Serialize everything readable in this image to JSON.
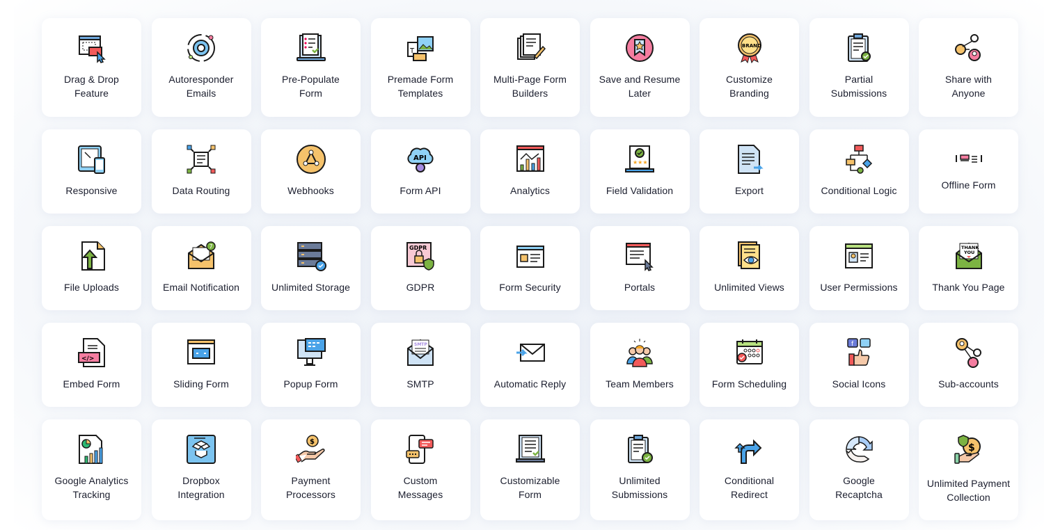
{
  "features": [
    [
      {
        "label": "Drag & Drop\nFeature",
        "icon": "drag-drop-icon"
      },
      {
        "label": "Autoresponder\nEmails",
        "icon": "gear-icon"
      },
      {
        "label": "Pre-Populate\nForm",
        "icon": "laptop-checklist-icon"
      },
      {
        "label": "Premade Form\nTemplates",
        "icon": "templates-icon"
      },
      {
        "label": "Multi-Page Form\nBuilders",
        "icon": "multi-page-icon"
      },
      {
        "label": "Save and Resume\nLater",
        "icon": "bookmark-icon"
      },
      {
        "label": "Customize\nBranding",
        "icon": "brand-badge-icon"
      },
      {
        "label": "Partial\nSubmissions",
        "icon": "clipboard-icon"
      },
      {
        "label": "Share with\nAnyone",
        "icon": "share-users-icon"
      }
    ],
    [
      {
        "label": "Responsive",
        "icon": "responsive-devices-icon"
      },
      {
        "label": "Data Routing",
        "icon": "data-routing-icon"
      },
      {
        "label": "Webhooks",
        "icon": "webhook-icon"
      },
      {
        "label": "Form API",
        "icon": "api-cloud-icon"
      },
      {
        "label": "Analytics",
        "icon": "analytics-chart-icon"
      },
      {
        "label": "Field Validation",
        "icon": "validation-laptop-icon"
      },
      {
        "label": "Export",
        "icon": "export-document-icon"
      },
      {
        "label": "Conditional Logic",
        "icon": "flowchart-icon"
      },
      {
        "label": "Offline Form",
        "icon": "offline-form-icon"
      }
    ],
    [
      {
        "label": "File Uploads",
        "icon": "file-upload-icon"
      },
      {
        "label": "Email Notification",
        "icon": "email-notification-icon"
      },
      {
        "label": "Unlimited Storage",
        "icon": "server-storage-icon"
      },
      {
        "label": "GDPR",
        "icon": "gdpr-lock-icon"
      },
      {
        "label": "Form Security",
        "icon": "form-security-icon"
      },
      {
        "label": "Portals",
        "icon": "portal-window-icon"
      },
      {
        "label": "Unlimited Views",
        "icon": "views-eye-icon"
      },
      {
        "label": "User Permissions",
        "icon": "user-permissions-icon"
      },
      {
        "label": "Thank You Page",
        "icon": "thank-you-envelope-icon"
      }
    ],
    [
      {
        "label": "Embed Form",
        "icon": "embed-code-icon"
      },
      {
        "label": "Sliding Form",
        "icon": "sliding-form-icon"
      },
      {
        "label": "Popup Form",
        "icon": "popup-monitor-icon"
      },
      {
        "label": "SMTP",
        "icon": "smtp-envelope-icon"
      },
      {
        "label": "Automatic Reply",
        "icon": "auto-reply-envelope-icon"
      },
      {
        "label": "Team Members",
        "icon": "team-members-icon"
      },
      {
        "label": "Form Scheduling",
        "icon": "calendar-icon"
      },
      {
        "label": "Social Icons",
        "icon": "social-thumbs-icon"
      },
      {
        "label": "Sub-accounts",
        "icon": "sub-accounts-icon"
      }
    ],
    [
      {
        "label": "Google Analytics\nTracking",
        "icon": "report-chart-icon"
      },
      {
        "label": "Dropbox\nIntegration",
        "icon": "dropbox-icon"
      },
      {
        "label": "Payment\nProcessors",
        "icon": "payment-hand-icon"
      },
      {
        "label": "Custom\nMessages",
        "icon": "phone-messages-icon"
      },
      {
        "label": "Customizable\nForm",
        "icon": "customizable-laptop-icon"
      },
      {
        "label": "Unlimited\nSubmissions",
        "icon": "submissions-clipboard-icon"
      },
      {
        "label": "Conditional\nRedirect",
        "icon": "redirect-arrows-icon"
      },
      {
        "label": "Google\nRecaptcha",
        "icon": "recaptcha-icon"
      },
      {
        "label": "Unlimited Payment\nCollection",
        "icon": "payment-collection-icon"
      }
    ]
  ]
}
